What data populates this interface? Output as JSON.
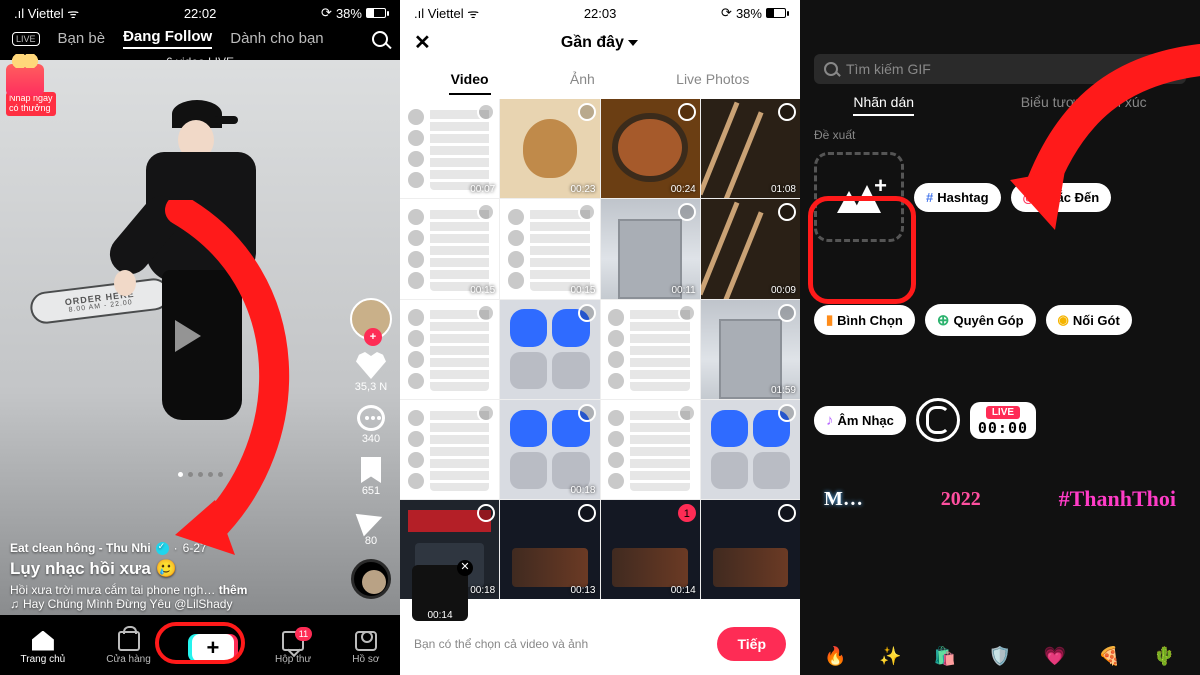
{
  "status": {
    "carrier": "Viettel",
    "t1": "22:02",
    "t2": "22:03",
    "battery": "38%"
  },
  "p1": {
    "tabs": [
      "Bạn bè",
      "Đang Follow",
      "Dành cho bạn"
    ],
    "live_row": "6 video LIVE",
    "gift": {
      "line1": "Nhấp ngay",
      "line2": "có thưởng"
    },
    "sign1": "ORDER HERE",
    "sign2": "8.00 AM - 22.00",
    "user": "Eat clean hông - Thu Nhi",
    "date": "6-27",
    "title": "Lụy nhạc hồi xưa 🥲",
    "caption": "Hồi xưa trời mưa cắm tai phone ngh…",
    "more": "thêm",
    "music": "Hay Chúng Mình Đừng Yêu    @LilShady",
    "counts": {
      "like": "35,3 N",
      "comment": "340",
      "save": "651",
      "share": "80"
    },
    "bar": {
      "home": "Trang chủ",
      "shop": "Cửa hàng",
      "inbox": "Hộp thư",
      "profile": "Hồ sơ",
      "badge": "11"
    }
  },
  "p2": {
    "title": "Gần đây",
    "tabs": [
      "Video",
      "Ảnh",
      "Live Photos"
    ],
    "durations": [
      "00:07",
      "00:23",
      "00:24",
      "01:08",
      "00:15",
      "00:15",
      "00:11",
      "00:09",
      "",
      "",
      "",
      "01:59",
      "",
      "00:18",
      "",
      "",
      "00:18",
      "00:13",
      "00:14",
      ""
    ],
    "selected_label": "1",
    "picked_dur": "00:14",
    "hint": "Bạn có thể chọn cả video và ảnh",
    "next": "Tiếp"
  },
  "p3": {
    "search": "Tìm kiếm GIF",
    "tabs": [
      "Nhãn dán",
      "Biểu tượng cảm xúc"
    ],
    "sec": "Đề xuất",
    "chips": {
      "hashtag": "Hashtag",
      "mention": "Nhắc Đến",
      "poll": "Bình Chọn",
      "donate": "Quyên Góp",
      "noigot": "Nối Gót",
      "music": "Âm Nhạc",
      "live_time": "00:00",
      "live": "LIVE",
      "year": "2022",
      "tt": "#ThanhThoi"
    }
  }
}
